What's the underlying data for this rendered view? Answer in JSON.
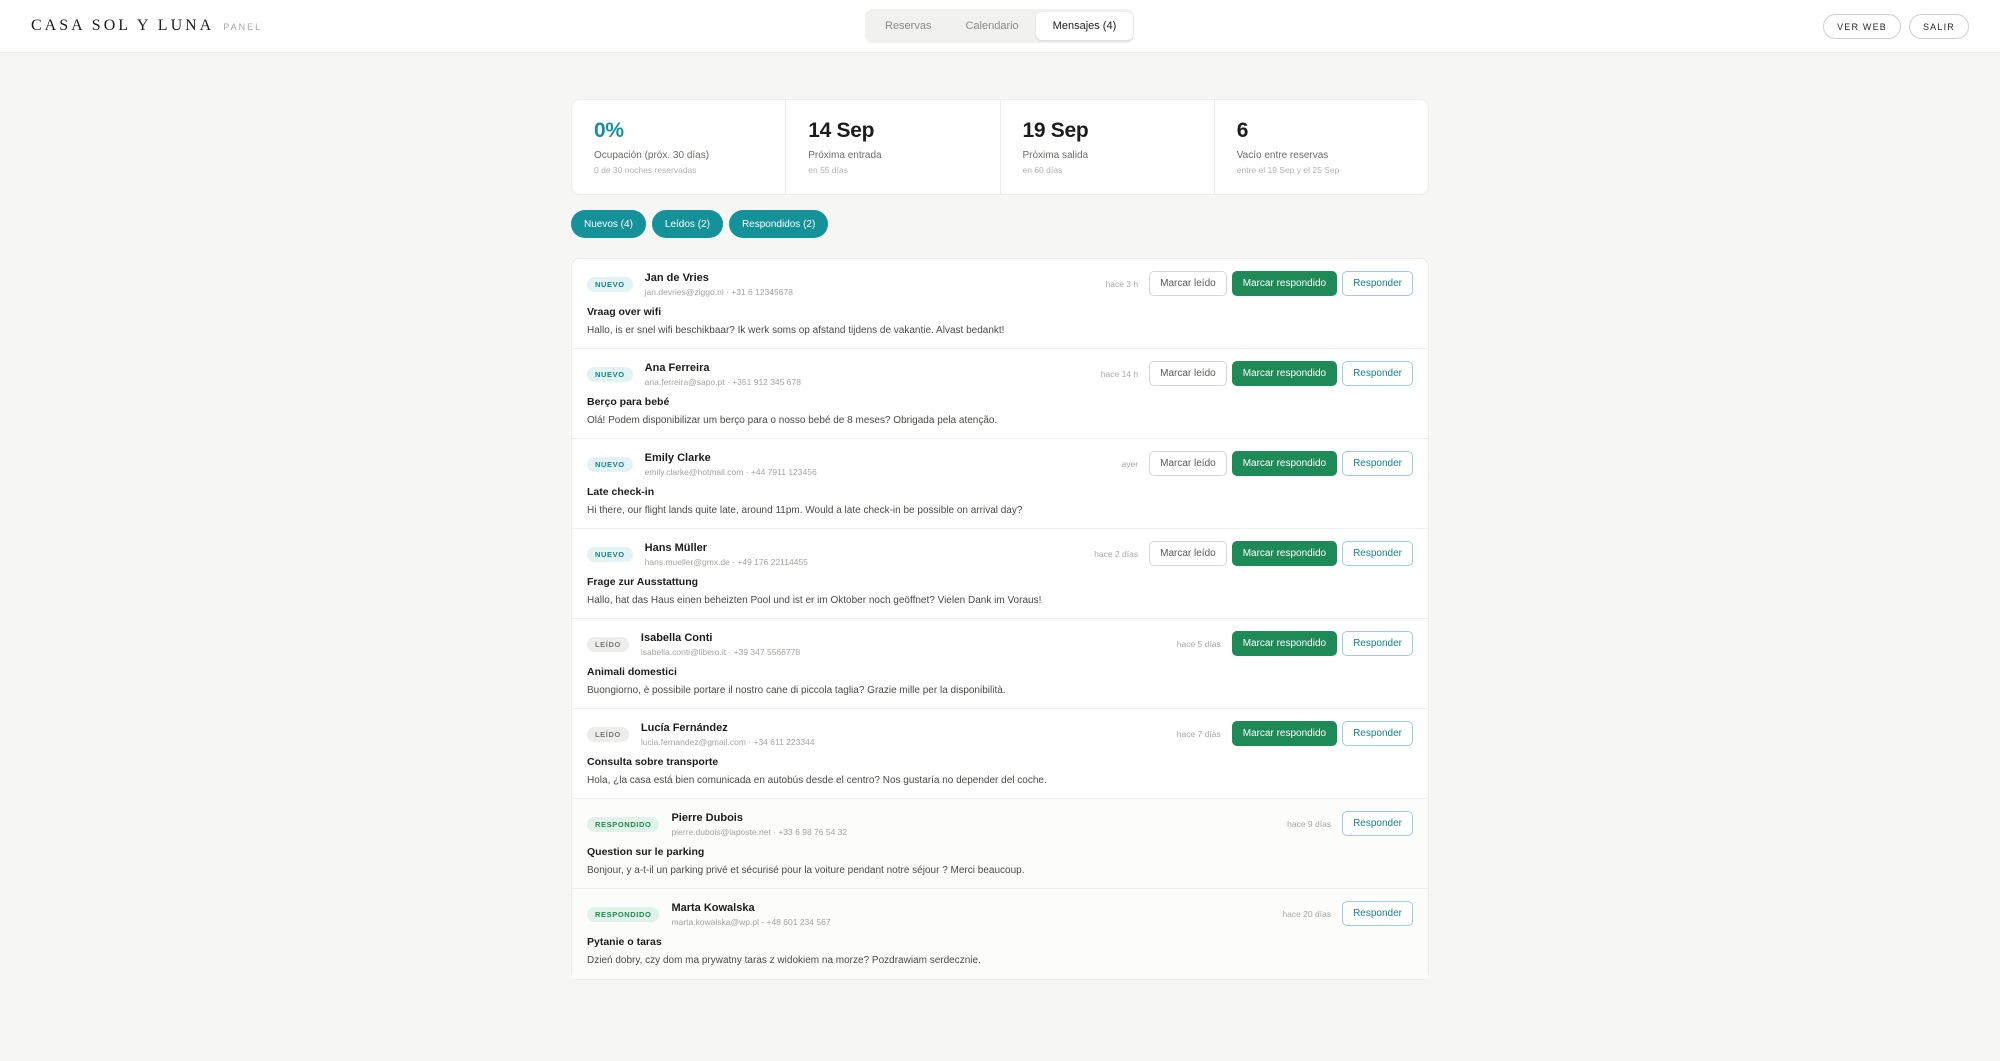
{
  "header": {
    "brand": "CASA SOL Y LUNA",
    "brand_sub": "PANEL",
    "nav": [
      {
        "label": "Reservas",
        "active": false
      },
      {
        "label": "Calendario",
        "active": false
      },
      {
        "label": "Mensajes (4)",
        "active": true
      }
    ],
    "view_web": "VER WEB",
    "logout": "SALIR"
  },
  "stats": [
    {
      "value": "0%",
      "label": "Ocupación (próx. 30 días)",
      "sub": "0 de 30 noches reservadas",
      "accent": "#149199"
    },
    {
      "value": "14 Sep",
      "label": "Próxima entrada",
      "sub": "en 55 días"
    },
    {
      "value": "19 Sep",
      "label": "Próxima salida",
      "sub": "en 60 días"
    },
    {
      "value": "6",
      "label": "Vacío entre reservas",
      "sub": "entre el 19 Sep y el 25 Sep"
    }
  ],
  "filters": [
    "Nuevos (4)",
    "Leídos (2)",
    "Respondidos (2)"
  ],
  "buttons": {
    "mark_read": "Marcar leído",
    "mark_responded": "Marcar respondido",
    "reply": "Responder"
  },
  "messages": [
    {
      "status": "nuevo",
      "badge": "NUEVO",
      "name": "Jan de Vries",
      "contact": "jan.devries@ziggo.nl · +31 6 12345678",
      "time": "hace 3 h",
      "subject": "Vraag over wifi",
      "body": "Hallo, is er snel wifi beschikbaar? Ik werk soms op afstand tijdens de vakantie. Alvast bedankt!"
    },
    {
      "status": "nuevo",
      "badge": "NUEVO",
      "name": "Ana Ferreira",
      "contact": "ana.ferreira@sapo.pt · +351 912 345 678",
      "time": "hace 14 h",
      "subject": "Berço para bebé",
      "body": "Olá! Podem disponibilizar um berço para o nosso bebé de 8 meses? Obrigada pela atenção."
    },
    {
      "status": "nuevo",
      "badge": "NUEVO",
      "name": "Emily Clarke",
      "contact": "emily.clarke@hotmail.com · +44 7911 123456",
      "time": "ayer",
      "subject": "Late check-in",
      "body": "Hi there, our flight lands quite late, around 11pm. Would a late check-in be possible on arrival day?"
    },
    {
      "status": "nuevo",
      "badge": "NUEVO",
      "name": "Hans Müller",
      "contact": "hans.mueller@gmx.de · +49 176 22114455",
      "time": "hace 2 días",
      "subject": "Frage zur Ausstattung",
      "body": "Hallo, hat das Haus einen beheizten Pool und ist er im Oktober noch geöffnet? Vielen Dank im Voraus!"
    },
    {
      "status": "leido",
      "badge": "LEÍDO",
      "name": "Isabella Conti",
      "contact": "isabella.conti@libero.it · +39 347 5566778",
      "time": "hace 5 días",
      "subject": "Animali domestici",
      "body": "Buongiorno, è possibile portare il nostro cane di piccola taglia? Grazie mille per la disponibilità."
    },
    {
      "status": "leido",
      "badge": "LEÍDO",
      "name": "Lucía Fernández",
      "contact": "lucia.fernandez@gmail.com · +34 611 223344",
      "time": "hace 7 días",
      "subject": "Consulta sobre transporte",
      "body": "Hola, ¿la casa está bien comunicada en autobús desde el centro? Nos gustaría no depender del coche."
    },
    {
      "status": "respondido",
      "badge": "RESPONDIDO",
      "name": "Pierre Dubois",
      "contact": "pierre.dubois@laposte.net · +33 6 98 76 54 32",
      "time": "hace 9 días",
      "subject": "Question sur le parking",
      "body": "Bonjour, y a-t-il un parking privé et sécurisé pour la voiture pendant notre séjour ? Merci beaucoup."
    },
    {
      "status": "respondido",
      "badge": "RESPONDIDO",
      "name": "Marta Kowalska",
      "contact": "marta.kowalska@wp.pl · +48 601 234 567",
      "time": "hace 20 días",
      "subject": "Pytanie o taras",
      "body": "Dzień dobry, czy dom ma prywatny taras z widokiem na morze? Pozdrawiam serdecznie."
    }
  ]
}
